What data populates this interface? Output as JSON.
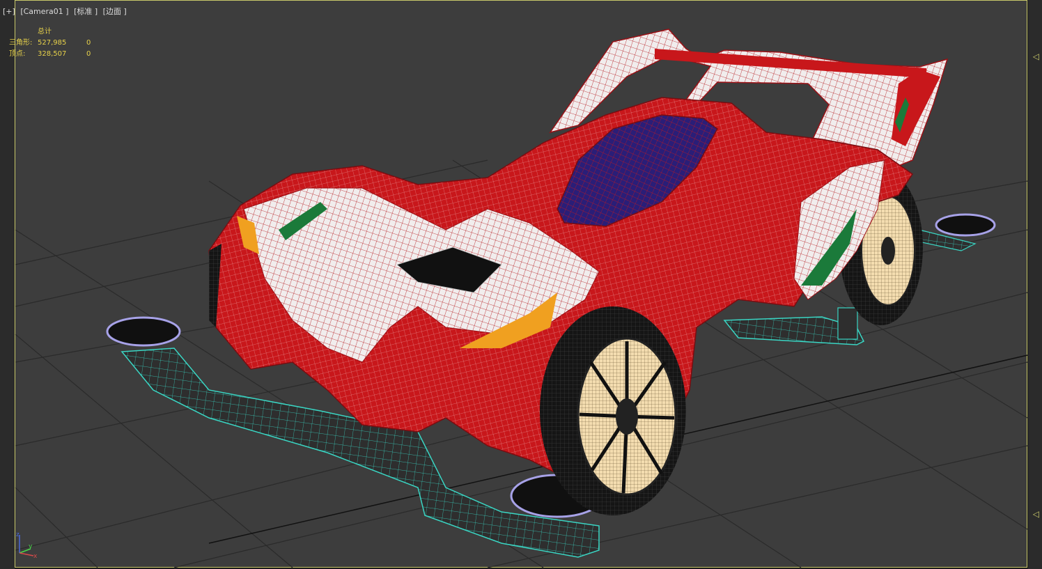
{
  "viewport": {
    "plus_label": "[+]",
    "camera_label": "[Camera01 ]",
    "shading_label": "[标准 ]",
    "edges_label": "[边面 ]"
  },
  "stats": {
    "header": "总计",
    "rows": [
      {
        "label": "三角形:",
        "value": "527,985",
        "selected": "0"
      },
      {
        "label": "顶点:",
        "value": "328,507",
        "selected": "0"
      }
    ]
  },
  "gizmo": {
    "z_label": "z",
    "y_label": "y",
    "x_label": "x"
  },
  "side_markers": [
    "◁",
    "◁"
  ],
  "colors": {
    "viewport_bg": "#3d3d3d",
    "border_active": "#c8c86a",
    "stats_text": "#e8d24a",
    "body_red": "#c8171b",
    "chassis_teal": "#3ad6c4",
    "canopy_blue": "#2a1e78"
  }
}
